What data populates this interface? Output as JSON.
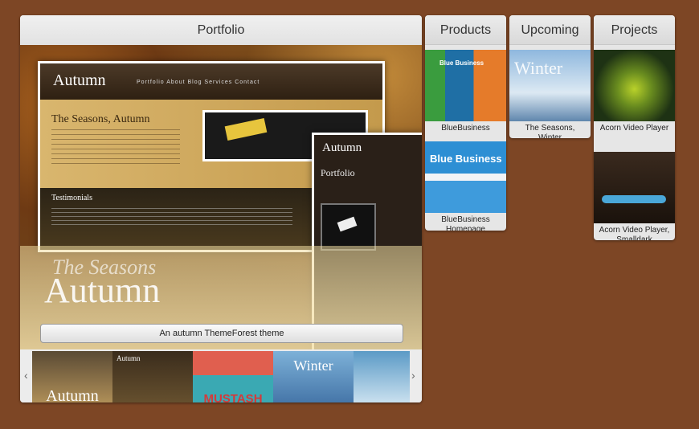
{
  "portfolio": {
    "title": "Portfolio",
    "slide": {
      "logo": "Autumn",
      "nav": "Portfolio  About  Blog  Services  Contact",
      "heading": "The Seasons, Autumn",
      "testimonials": "Testimonials",
      "side_logo": "Autumn",
      "side_section": "Portfolio",
      "big_small": "The Seasons",
      "big_large": "Autumn",
      "caption": "An autumn ThemeForest theme"
    },
    "thumbs": [
      {
        "title": "Autumn"
      },
      {
        "title": "Autumn"
      },
      {
        "title": "MUSTASH"
      },
      {
        "title": "Winter"
      },
      {
        "title": ""
      }
    ],
    "prev_icon": "chevron-left-icon",
    "next_icon": "chevron-right-icon"
  },
  "products": {
    "title": "Products",
    "items": [
      {
        "label": "BlueBusiness"
      },
      {
        "label": "BlueBusiness Homepage"
      }
    ]
  },
  "upcoming": {
    "title": "Upcoming",
    "items": [
      {
        "label": "The Seasons, Winter"
      }
    ]
  },
  "projects": {
    "title": "Projects",
    "items": [
      {
        "label": "Acorn Video Player"
      },
      {
        "label": "Acorn Video Player, Smalldark"
      }
    ]
  },
  "colors": {
    "background": "#7d4625",
    "panel": "#e6e6e6"
  }
}
